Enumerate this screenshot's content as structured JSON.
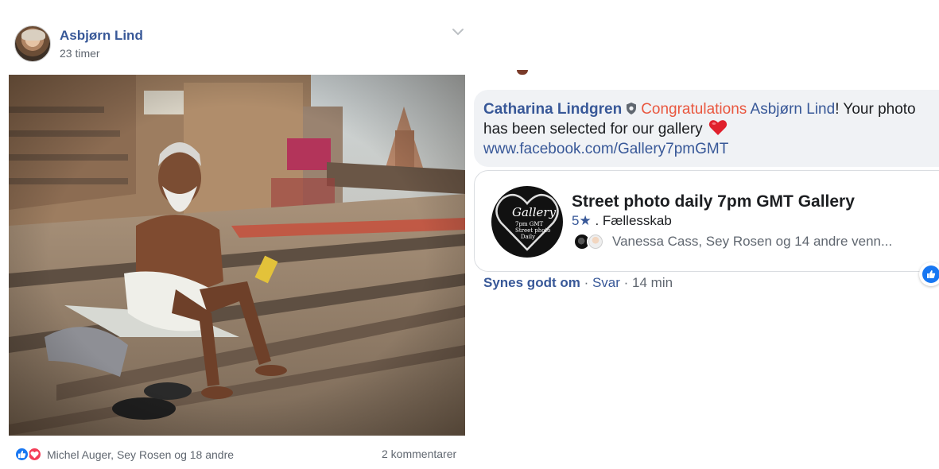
{
  "post": {
    "author": "Asbjørn Lind",
    "time": "23 timer",
    "reactions_text": "Michel Auger, Sey Rosen og 18 andre",
    "comments_text": "2 kommentarer"
  },
  "comment": {
    "author": "Catharina Lindgren",
    "congrats": "Congratulations",
    "mention": "Asbjørn Lind",
    "text_part1": "! Your photo",
    "text_part2": "has been selected for our gallery",
    "link": "www.facebook.com/Gallery7pmGMT"
  },
  "card": {
    "title": "Street photo daily 7pm GMT Gallery",
    "rating": "5",
    "category": ". Fællesskab",
    "friends": "Vanessa Cass, Sey Rosen og 14 andre venn...",
    "logo_title": "Gallery",
    "logo_sub": "7pm GMT\nStreet photo\nDaily"
  },
  "actions": {
    "like": "Synes godt om",
    "sep1": " · ",
    "reply": "Svar",
    "sep2": " · ",
    "time": "14 min"
  },
  "colors": {
    "link_blue": "#385898",
    "fb_blue": "#1877f2",
    "love_red": "#f33e58",
    "congrats_orange": "#e9573f",
    "bubble_gray": "#f0f2f5"
  },
  "icons": [
    "chevron-down-icon",
    "like-icon",
    "love-icon",
    "shield-icon",
    "heart-emoji-icon",
    "star-icon"
  ]
}
